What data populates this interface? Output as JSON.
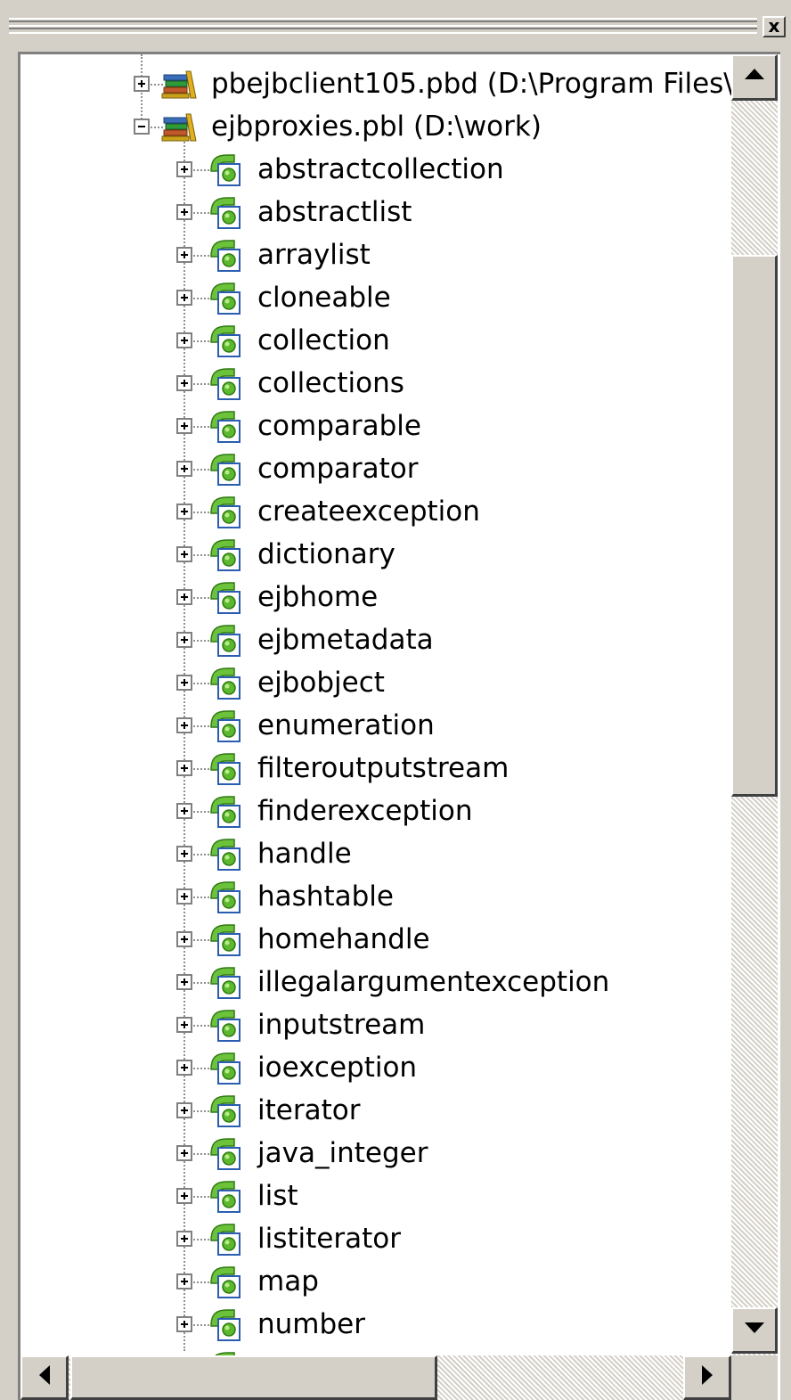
{
  "window": {
    "close_label": "x"
  },
  "tree": {
    "libraries": [
      {
        "label": "pbejbclient105.pbd (D:\\Program Files\\",
        "expanded": false,
        "icon": "library-books-icon"
      },
      {
        "label": "ejbproxies.pbl (D:\\work)",
        "expanded": true,
        "icon": "library-books-icon"
      }
    ],
    "items": [
      "abstractcollection",
      "abstractlist",
      "arraylist",
      "cloneable",
      "collection",
      "collections",
      "comparable",
      "comparator",
      "createexception",
      "dictionary",
      "ejbhome",
      "ejbmetadata",
      "ejbobject",
      "enumeration",
      "filteroutputstream",
      "finderexception",
      "handle",
      "hashtable",
      "homehandle",
      "illegalargumentexception",
      "inputstream",
      "ioexception",
      "iterator",
      "java_integer",
      "list",
      "listiterator",
      "map",
      "number"
    ],
    "item_icon": "proxy-object-icon"
  },
  "colors": {
    "window_bg": "#d4d0c8",
    "tree_bg": "#ffffff",
    "proxy_green": "#5cb82e",
    "proxy_frame_blue": "#2a5db0"
  }
}
